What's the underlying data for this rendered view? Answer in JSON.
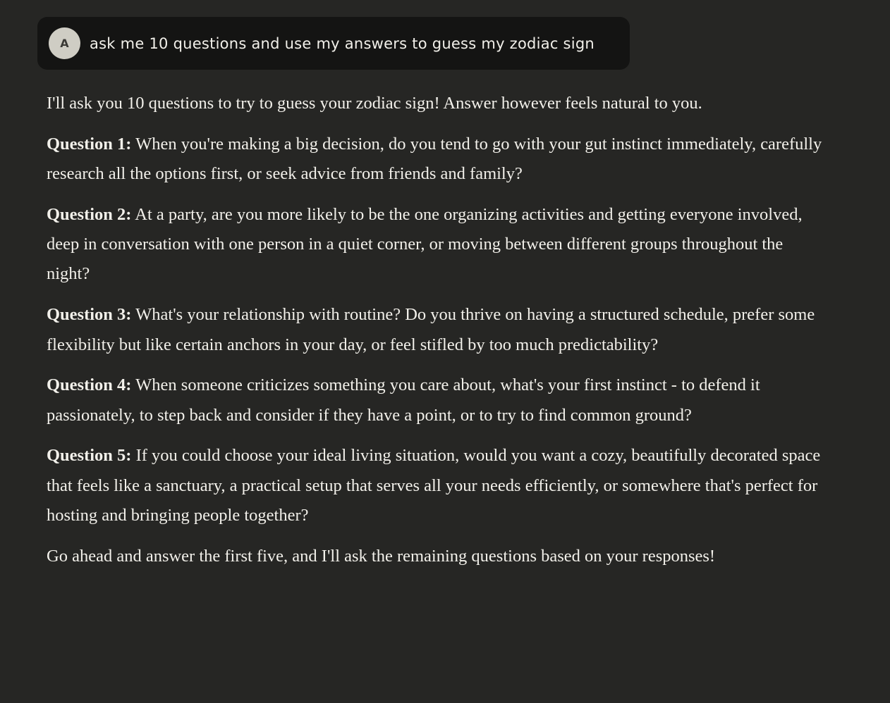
{
  "user_message": {
    "avatar_initial": "A",
    "text": "ask me 10 questions and use my answers to guess my zodiac sign"
  },
  "response": {
    "intro": "I'll ask you 10 questions to try to guess your zodiac sign! Answer however feels natural to you.",
    "questions": [
      {
        "label": "Question 1:",
        "text": "When you're making a big decision, do you tend to go with your gut instinct immediately, carefully research all the options first, or seek advice from friends and family?"
      },
      {
        "label": "Question 2:",
        "text": "At a party, are you more likely to be the one organizing activities and getting everyone involved, deep in conversation with one person in a quiet corner, or moving between different groups throughout the night?"
      },
      {
        "label": "Question 3:",
        "text": "What's your relationship with routine? Do you thrive on having a structured schedule, prefer some flexibility but like certain anchors in your day, or feel stifled by too much predictability?"
      },
      {
        "label": "Question 4:",
        "text": "When someone criticizes something you care about, what's your first instinct - to defend it passionately, to step back and consider if they have a point, or to try to find common ground?"
      },
      {
        "label": "Question 5:",
        "text": "If you could choose your ideal living situation, would you want a cozy, beautifully decorated space that feels like a sanctuary, a practical setup that serves all your needs efficiently, or somewhere that's perfect for hosting and bringing people together?"
      }
    ],
    "outro": "Go ahead and answer the first five, and I'll ask the remaining questions based on your responses!"
  }
}
